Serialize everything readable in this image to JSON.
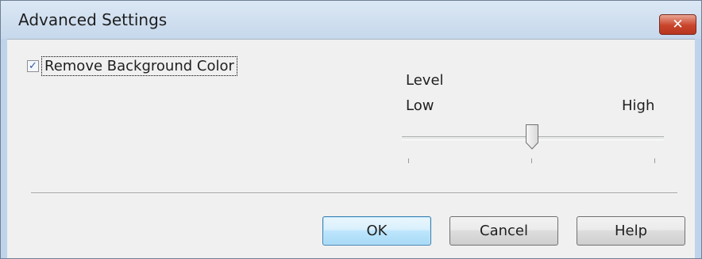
{
  "window": {
    "title": "Advanced Settings",
    "close_label": "✕"
  },
  "options": {
    "remove_background_color": {
      "label": "Remove Background Color",
      "checked": true,
      "check_glyph": "✓"
    }
  },
  "level": {
    "heading": "Level",
    "min_label": "Low",
    "max_label": "High",
    "value_fraction": 0.5,
    "tick_count": 3
  },
  "buttons": {
    "ok_label": "OK",
    "cancel_label": "Cancel",
    "help_label": "Help"
  },
  "colors": {
    "titlebar": "#c6d8ec",
    "close_button": "#c9442b",
    "default_button_border": "#3c7fb1"
  }
}
